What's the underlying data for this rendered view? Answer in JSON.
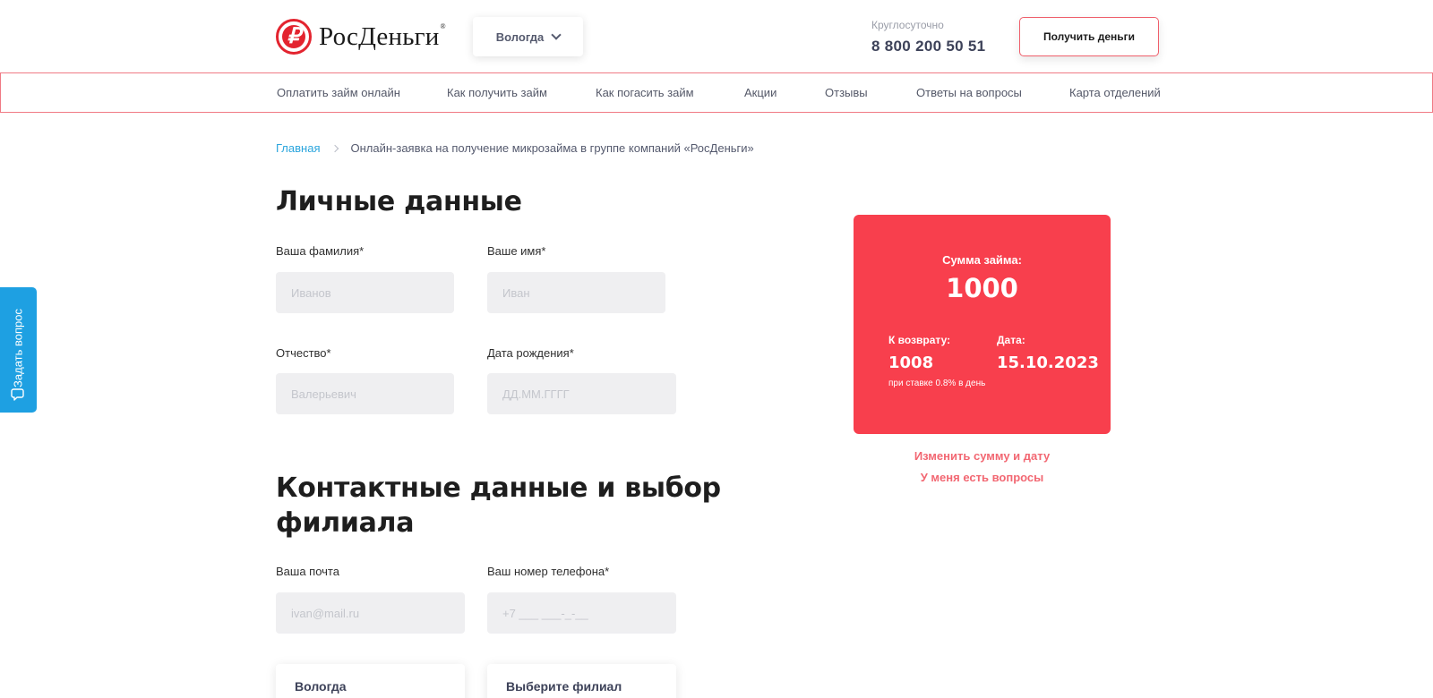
{
  "header": {
    "logo_text": "РосДеньги",
    "logo_glyph": "₽",
    "logo_registered": "®",
    "city": "Вологда",
    "hours_label": "Круглосуточно",
    "phone": "8 800 200 50 51",
    "cta_label": "Получить деньги"
  },
  "nav": {
    "items": [
      {
        "label": "Оплатить займ онлайн"
      },
      {
        "label": "Как получить займ"
      },
      {
        "label": "Как погасить займ"
      },
      {
        "label": "Акции"
      },
      {
        "label": "Отзывы"
      },
      {
        "label": "Ответы на вопросы"
      },
      {
        "label": "Карта отделений"
      }
    ]
  },
  "breadcrumb": {
    "home": "Главная",
    "current": "Онлайн-заявка на получение микрозайма в группе компаний «РосДеньги»"
  },
  "personal": {
    "heading": "Личные данные",
    "fields": {
      "surname": {
        "label": "Ваша фамилия*",
        "placeholder": "Иванов",
        "value": ""
      },
      "name": {
        "label": "Ваше имя*",
        "placeholder": "Иван",
        "value": ""
      },
      "patronymic": {
        "label": "Отчество*",
        "placeholder": "Валерьевич",
        "value": ""
      },
      "birthdate": {
        "label": "Дата рождения*",
        "placeholder": "ДД.ММ.ГГГГ",
        "value": ""
      }
    }
  },
  "contact": {
    "heading_line1": "Контактные данные и выбор",
    "heading_line2": "филиала",
    "fields": {
      "email": {
        "label": "Ваша почта",
        "placeholder": "ivan@mail.ru",
        "value": ""
      },
      "phone": {
        "label": "Ваш номер телефона*",
        "placeholder": "+7 ___ ___-_-__",
        "value": ""
      }
    },
    "city_select": "Вологда",
    "branch_select": "Выберите филиал"
  },
  "loan_card": {
    "title": "Сумма займа:",
    "amount": "1000",
    "return_label": "К возврату:",
    "return_value": "1008",
    "rate_note": "при ставке 0.8% в день",
    "date_label": "Дата:",
    "date_value": "15.10.2023",
    "bg_color": "#f83f4d"
  },
  "links": {
    "change": "Изменить сумму и дату",
    "questions": "У меня есть вопросы"
  },
  "side_tab": {
    "label": "Задать вопрос",
    "icon": "chat-bubble-icon"
  }
}
